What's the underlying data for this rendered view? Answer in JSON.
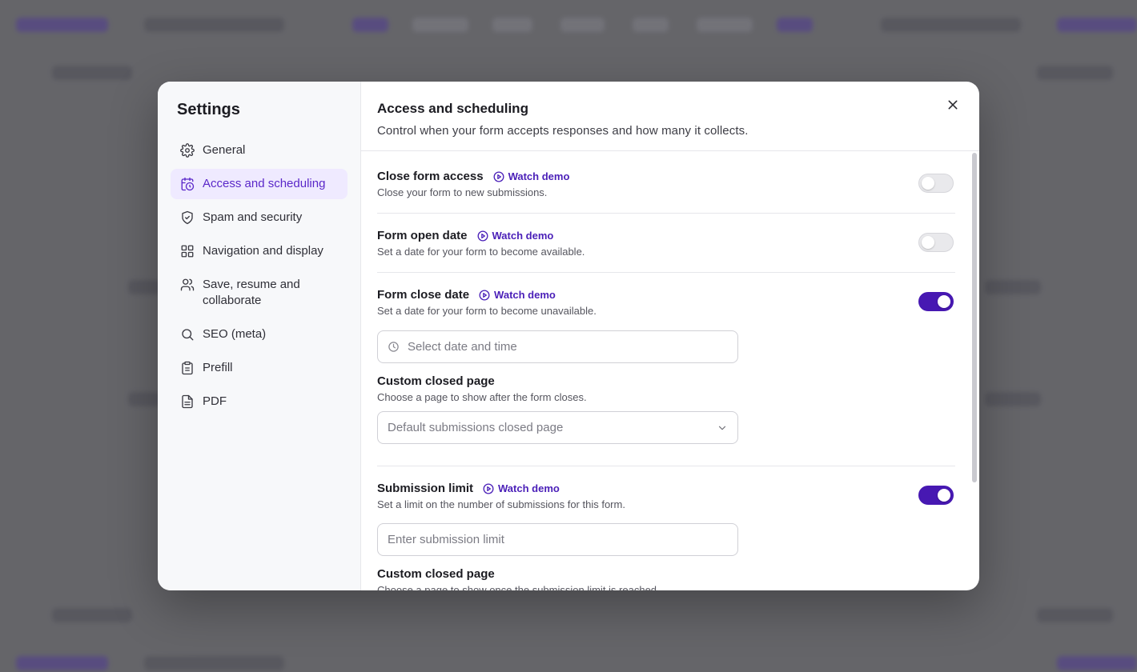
{
  "sidebar": {
    "title": "Settings",
    "items": [
      {
        "label": "General",
        "icon": "gear-icon"
      },
      {
        "label": "Access and scheduling",
        "icon": "calendar-clock-icon",
        "active": true
      },
      {
        "label": "Spam and security",
        "icon": "shield-icon"
      },
      {
        "label": "Navigation and display",
        "icon": "grid-icon"
      },
      {
        "label": "Save, resume and collaborate",
        "icon": "users-icon"
      },
      {
        "label": "SEO (meta)",
        "icon": "search-icon"
      },
      {
        "label": "Prefill",
        "icon": "clipboard-icon"
      },
      {
        "label": "PDF",
        "icon": "document-icon"
      }
    ]
  },
  "header": {
    "title": "Access and scheduling",
    "subtitle": "Control when your form accepts responses and how many it collects."
  },
  "demo_label": "Watch demo",
  "sections": {
    "close_access": {
      "title": "Close form access",
      "desc": "Close your form to new submissions.",
      "enabled": false
    },
    "open_date": {
      "title": "Form open date",
      "desc": "Set a date for your form to become available.",
      "enabled": false
    },
    "close_date": {
      "title": "Form close date",
      "desc": "Set a date for your form to become unavailable.",
      "enabled": true,
      "date_placeholder": "Select date and time",
      "closed_page_label": "Custom closed page",
      "closed_page_desc": "Choose a page to show after the form closes.",
      "closed_page_value": "Default submissions closed page"
    },
    "submission_limit": {
      "title": "Submission limit",
      "desc": "Set a limit on the number of submissions for this form.",
      "enabled": true,
      "limit_placeholder": "Enter submission limit",
      "closed_page_label": "Custom closed page",
      "closed_page_desc": "Choose a page to show once the submission limit is reached."
    }
  },
  "colors": {
    "accent": "#4718b2",
    "active_bg": "#efeaff"
  }
}
